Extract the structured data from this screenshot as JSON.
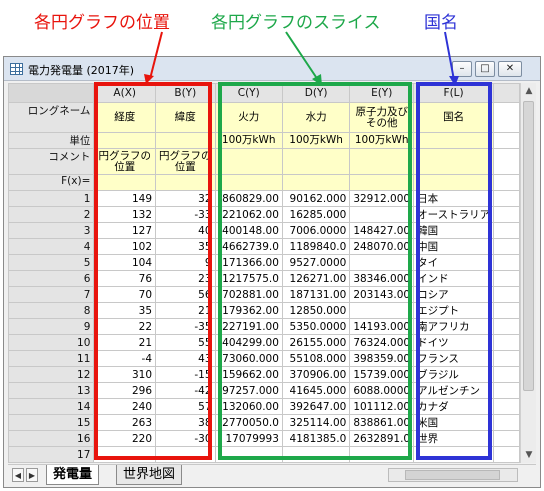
{
  "annotations": {
    "pie_position": "各円グラフの位置",
    "pie_slices": "各円グラフのスライス",
    "country_name": "国名",
    "colors": {
      "red": "#e8140d",
      "green": "#1ea84a",
      "blue": "#2e33d6"
    }
  },
  "window": {
    "title": "電力発電量 (2017年)",
    "minimize": "–",
    "maximize": "□",
    "close": "✕"
  },
  "columns": [
    "A(X)",
    "B(Y)",
    "C(Y)",
    "D(Y)",
    "E(Y)",
    "F(L)"
  ],
  "meta": {
    "longname_label": "ロングネーム",
    "longnames": [
      "経度",
      "緯度",
      "火力",
      "水力",
      "原子力及び\nその他",
      "国名"
    ],
    "unit_label": "単位",
    "units": [
      "",
      "",
      "100万kWh",
      "100万kWh",
      "100万kWh",
      ""
    ],
    "comment_label": "コメント",
    "comments": [
      "円グラフの\n位置",
      "円グラフの\n位置",
      "",
      "",
      "",
      ""
    ],
    "fx_label": "F(x)="
  },
  "rows": [
    [
      "1",
      "149",
      "32",
      "860829.00",
      "90162.000",
      "32912.000",
      "日本"
    ],
    [
      "2",
      "132",
      "-33",
      "221062.00",
      "16285.000",
      "",
      "オーストラリア"
    ],
    [
      "3",
      "127",
      "40",
      "400148.00",
      "7006.0000",
      "148427.00",
      "韓国"
    ],
    [
      "4",
      "102",
      "35",
      "4662739.0",
      "1189840.0",
      "248070.00",
      "中国"
    ],
    [
      "5",
      "104",
      "9",
      "171366.00",
      "9527.0000",
      "",
      "タイ"
    ],
    [
      "6",
      "76",
      "23",
      "1217575.0",
      "126271.00",
      "38346.000",
      "インド"
    ],
    [
      "7",
      "70",
      "56",
      "702881.00",
      "187131.00",
      "203143.00",
      "ロシア"
    ],
    [
      "8",
      "35",
      "21",
      "179362.00",
      "12850.000",
      "",
      "エジプト"
    ],
    [
      "9",
      "22",
      "-35",
      "227191.00",
      "5350.0000",
      "14193.000",
      "南アフリカ"
    ],
    [
      "10",
      "21",
      "55",
      "404299.00",
      "26155.000",
      "76324.000",
      "ドイツ"
    ],
    [
      "11",
      "-4",
      "43",
      "73060.000",
      "55108.000",
      "398359.00",
      "フランス"
    ],
    [
      "12",
      "310",
      "-15",
      "159662.00",
      "370906.00",
      "15739.000",
      "ブラジル"
    ],
    [
      "13",
      "296",
      "-42",
      "97257.000",
      "41645.000",
      "6088.0000",
      "アルゼンチン"
    ],
    [
      "14",
      "240",
      "57",
      "132060.00",
      "392647.00",
      "101112.00",
      "カナダ"
    ],
    [
      "15",
      "263",
      "38",
      "2770050.0",
      "325114.00",
      "838861.00",
      "米国"
    ],
    [
      "16",
      "220",
      "-30",
      "17079993",
      "4181385.0",
      "2632891.0",
      "世界"
    ],
    [
      "17",
      "",
      "",
      "",
      "",
      "",
      ""
    ]
  ],
  "tabs": {
    "active": "発電量",
    "inactive": "世界地図"
  },
  "nav": {
    "prev": "◀",
    "next": "▶",
    "up": "▲",
    "down": "▼"
  }
}
